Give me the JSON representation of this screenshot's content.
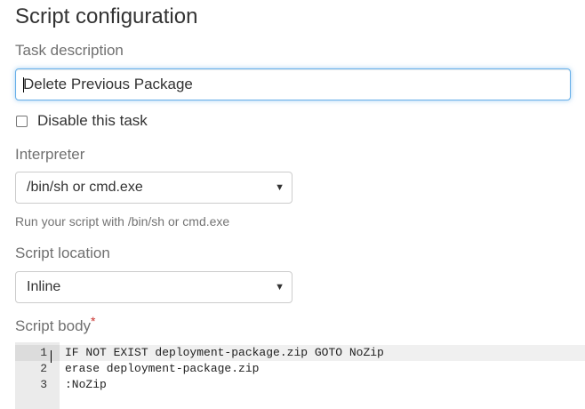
{
  "section_title": "Script configuration",
  "task_description": {
    "label": "Task description",
    "value": "Delete Previous Package"
  },
  "disable_task": {
    "label": "Disable this task",
    "checked": false
  },
  "interpreter": {
    "label": "Interpreter",
    "selected": "/bin/sh or cmd.exe",
    "help": "Run your script with /bin/sh or cmd.exe"
  },
  "script_location": {
    "label": "Script location",
    "selected": "Inline"
  },
  "script_body": {
    "label": "Script body",
    "required_marker": "*",
    "lines": [
      {
        "number": "1",
        "text": "IF NOT EXIST deployment-package.zip GOTO NoZip"
      },
      {
        "number": "2",
        "text": "erase deployment-package.zip"
      },
      {
        "number": "3",
        "text": ":NoZip"
      }
    ]
  },
  "icons": {
    "dropdown_caret": "▼"
  },
  "colors": {
    "focus_border": "#66afe9",
    "required": "#c9302c",
    "label": "#707070"
  }
}
